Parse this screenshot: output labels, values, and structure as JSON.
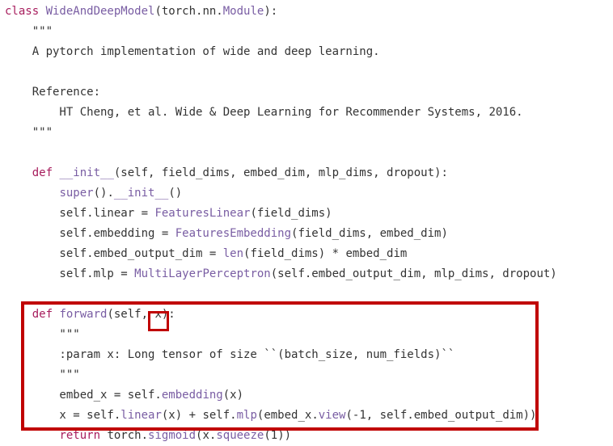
{
  "code": {
    "lines": [
      [
        {
          "t": "class ",
          "c": "kw"
        },
        {
          "t": "WideAndDeepModel",
          "c": "cls"
        },
        {
          "t": "(torch.nn.",
          "c": "plain"
        },
        {
          "t": "Module",
          "c": "cls"
        },
        {
          "t": "):",
          "c": "plain"
        }
      ],
      [
        {
          "t": "    \"\"\"",
          "c": "str"
        }
      ],
      [
        {
          "t": "    A pytorch implementation of wide and deep learning.",
          "c": "str"
        }
      ],
      [
        {
          "t": "",
          "c": "plain"
        }
      ],
      [
        {
          "t": "    Reference:",
          "c": "str"
        }
      ],
      [
        {
          "t": "        HT Cheng, et al. Wide & Deep Learning for Recommender Systems, 2016.",
          "c": "str"
        }
      ],
      [
        {
          "t": "    \"\"\"",
          "c": "str"
        }
      ],
      [
        {
          "t": "",
          "c": "plain"
        }
      ],
      [
        {
          "t": "    ",
          "c": "plain"
        },
        {
          "t": "def ",
          "c": "kw"
        },
        {
          "t": "__init__",
          "c": "fn"
        },
        {
          "t": "(self, field_dims, embed_dim, mlp_dims, dropout):",
          "c": "plain"
        }
      ],
      [
        {
          "t": "        ",
          "c": "plain"
        },
        {
          "t": "super",
          "c": "fn"
        },
        {
          "t": "().",
          "c": "plain"
        },
        {
          "t": "__init__",
          "c": "fn"
        },
        {
          "t": "()",
          "c": "plain"
        }
      ],
      [
        {
          "t": "        self.linear = ",
          "c": "plain"
        },
        {
          "t": "FeaturesLinear",
          "c": "fn"
        },
        {
          "t": "(field_dims)",
          "c": "plain"
        }
      ],
      [
        {
          "t": "        self.embedding = ",
          "c": "plain"
        },
        {
          "t": "FeaturesEmbedding",
          "c": "fn"
        },
        {
          "t": "(field_dims, embed_dim)",
          "c": "plain"
        }
      ],
      [
        {
          "t": "        self.embed_output_dim = ",
          "c": "plain"
        },
        {
          "t": "len",
          "c": "fn"
        },
        {
          "t": "(field_dims) * embed_dim",
          "c": "plain"
        }
      ],
      [
        {
          "t": "        self.mlp = ",
          "c": "plain"
        },
        {
          "t": "MultiLayerPerceptron",
          "c": "fn"
        },
        {
          "t": "(self.embed_output_dim, mlp_dims, dropout)",
          "c": "plain"
        }
      ],
      [
        {
          "t": "",
          "c": "plain"
        }
      ],
      [
        {
          "t": "    ",
          "c": "plain"
        },
        {
          "t": "def ",
          "c": "kw"
        },
        {
          "t": "forward",
          "c": "fn"
        },
        {
          "t": "(self, x):",
          "c": "plain"
        }
      ],
      [
        {
          "t": "        \"\"\"",
          "c": "str"
        }
      ],
      [
        {
          "t": "        :param x: Long tensor of size ``(batch_size, num_fields)``",
          "c": "str"
        }
      ],
      [
        {
          "t": "        \"\"\"",
          "c": "str"
        }
      ],
      [
        {
          "t": "        embed_x = self.",
          "c": "plain"
        },
        {
          "t": "embedding",
          "c": "fn"
        },
        {
          "t": "(x)",
          "c": "plain"
        }
      ],
      [
        {
          "t": "        x = self.",
          "c": "plain"
        },
        {
          "t": "linear",
          "c": "fn"
        },
        {
          "t": "(x) + self.",
          "c": "plain"
        },
        {
          "t": "mlp",
          "c": "fn"
        },
        {
          "t": "(embed_x.",
          "c": "plain"
        },
        {
          "t": "view",
          "c": "fn"
        },
        {
          "t": "(-1, self.embed_output_dim))",
          "c": "plain"
        }
      ],
      [
        {
          "t": "        ",
          "c": "plain"
        },
        {
          "t": "return ",
          "c": "kw"
        },
        {
          "t": "torch.",
          "c": "plain"
        },
        {
          "t": "sigmoid",
          "c": "fn"
        },
        {
          "t": "(x.",
          "c": "plain"
        },
        {
          "t": "squeeze",
          "c": "fn"
        },
        {
          "t": "(1))",
          "c": "plain"
        }
      ]
    ]
  },
  "colors": {
    "keyword": "#a71d5d",
    "function": "#795da3",
    "text": "#333333",
    "highlight": "#c00000"
  }
}
